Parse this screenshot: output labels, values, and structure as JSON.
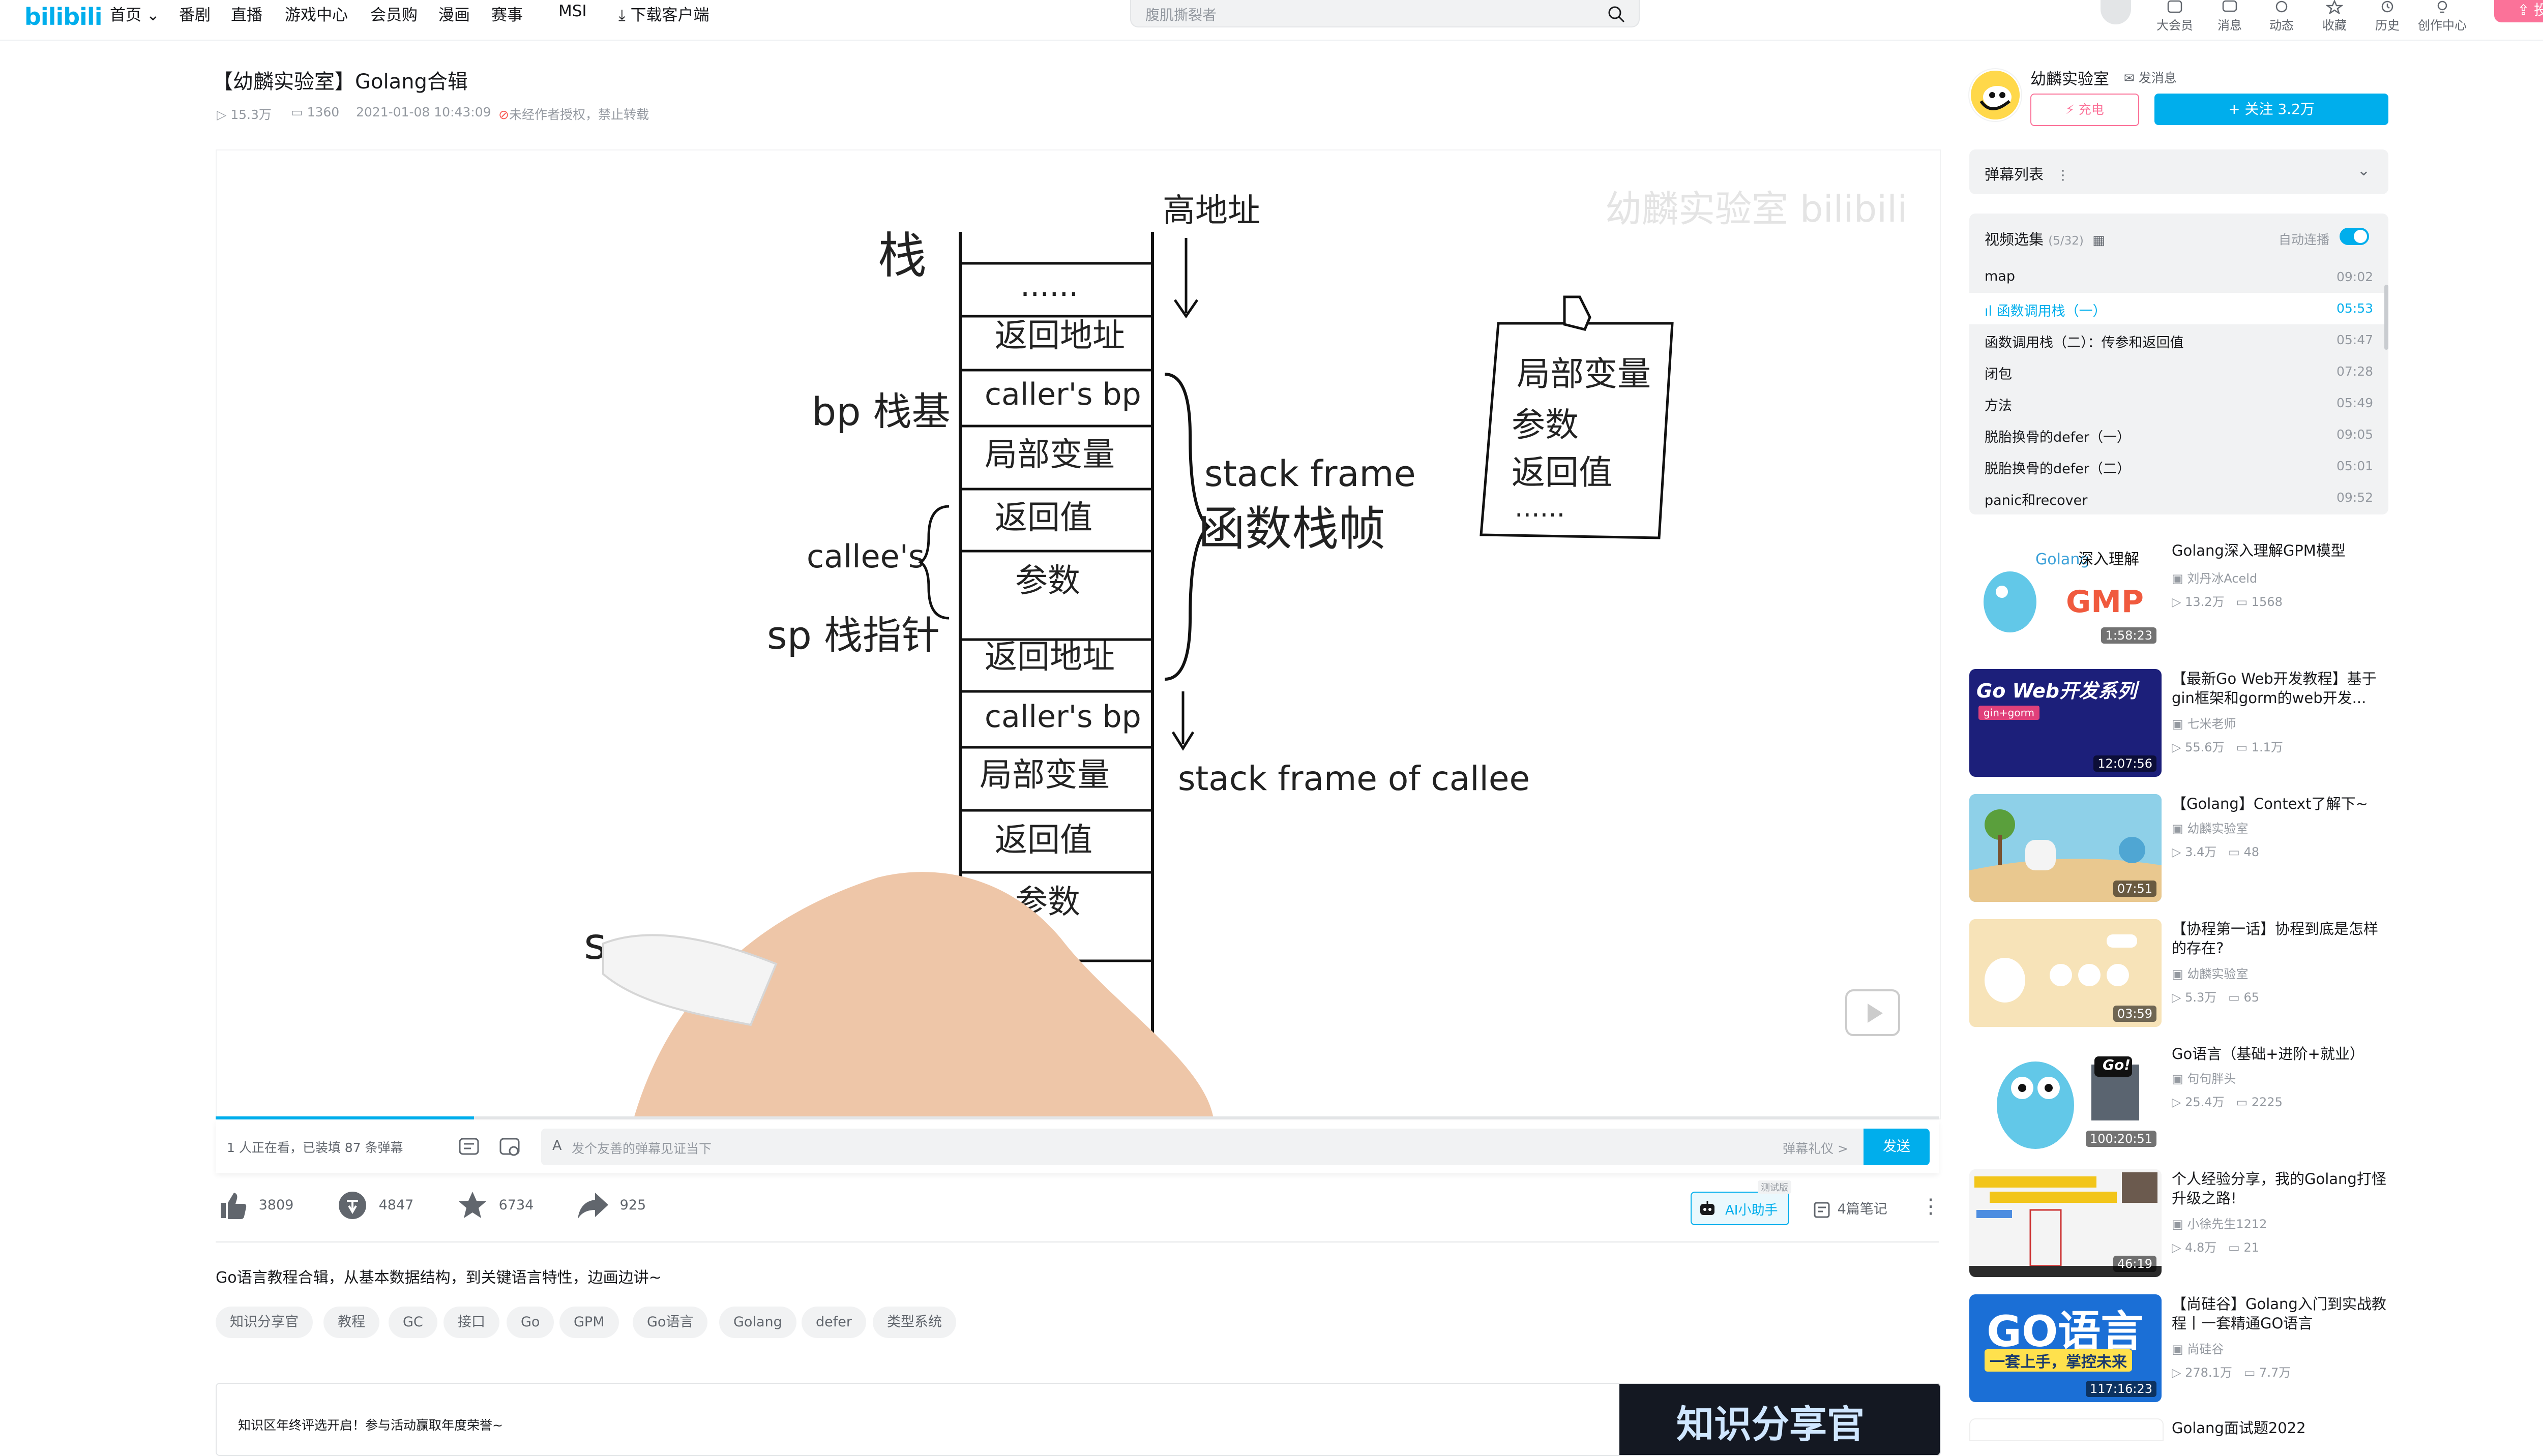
{
  "header": {
    "logo": "bilibili",
    "nav": [
      "首页",
      "番剧",
      "直播",
      "游戏中心",
      "会员购",
      "漫画",
      "赛事",
      "MSI",
      "下载客户端"
    ],
    "search_placeholder": "腹肌撕裂者",
    "icons": [
      "大会员",
      "消息",
      "动态",
      "收藏",
      "历史",
      "创作中心"
    ],
    "upload": "投稿"
  },
  "video": {
    "title": "【幼麟实验室】Golang合辑",
    "views": "15.3万",
    "danmaku_count": "1360",
    "date": "2021-01-08 10:43:09",
    "copyright": "未经作者授权，禁止转载",
    "watermark": "幼麟实验室 bilibili",
    "frame_labels": {
      "stack": "栈",
      "high_addr": "高地址",
      "bp": "bp 栈基",
      "callees": "callee's",
      "sp": "sp 栈指针",
      "stack_frame_en": "stack frame",
      "stack_frame_cn": "函数栈帧",
      "stack_frame_callee": "stack frame of callee",
      "cells": [
        "......",
        "返回地址",
        "caller's bp",
        "局部变量",
        "返回值",
        "参数",
        "返回地址",
        "caller's bp",
        "局部变量",
        "返回值",
        "参数"
      ],
      "note": [
        "局部变量",
        "参数",
        "返回值",
        "......"
      ],
      "writing": "s"
    },
    "progress": 0.15
  },
  "danmaku_bar": {
    "viewers": "1 人正在看，已装填 87 条弹幕",
    "placeholder": "发个友善的弹幕见证当下",
    "etiquette": "弹幕礼仪 >",
    "send": "发送"
  },
  "toolbar": {
    "like": "3809",
    "coin": "4847",
    "favorite": "6734",
    "share": "925",
    "ai_badge": "测试版",
    "ai_assistant": "AI小助手",
    "notes": "4篇笔记"
  },
  "description": "Go语言教程合辑，从基本数据结构，到关键语言特性，边画边讲~",
  "tags": [
    "知识分享官",
    "教程",
    "GC",
    "接口",
    "Go",
    "GPM",
    "Go语言",
    "Golang",
    "defer",
    "类型系统"
  ],
  "banner": {
    "text": "知识区年终评选开启！参与活动赢取年度荣誉~",
    "image_text": "知识分享官"
  },
  "uploader": {
    "name": "幼麟实验室",
    "message": "发消息",
    "charge": "充电",
    "follow": "+ 关注 3.2万"
  },
  "danmaku_list": {
    "title": "弹幕列表"
  },
  "playlist": {
    "title": "视频选集",
    "count": "(5/32)",
    "autoplay": "自动连播",
    "episodes": [
      {
        "title": "map",
        "duration": "09:02"
      },
      {
        "title": "函数调用栈（一）",
        "duration": "05:53"
      },
      {
        "title": "函数调用栈（二）：传参和返回值",
        "duration": "05:47"
      },
      {
        "title": "闭包",
        "duration": "07:28"
      },
      {
        "title": "方法",
        "duration": "05:49"
      },
      {
        "title": "脱胎换骨的defer（一）",
        "duration": "09:05"
      },
      {
        "title": "脱胎换骨的defer（二）",
        "duration": "05:01"
      },
      {
        "title": "panic和recover",
        "duration": "09:52"
      }
    ],
    "active_index": 1
  },
  "recommendations": [
    {
      "title": "Golang深入理解GPM模型",
      "up": "刘丹冰Aceld",
      "views": "13.2万",
      "danmaku": "1568",
      "duration": "1:58:23",
      "thumb_text": "Golang 深入理解 GMP",
      "color": "#ffffff"
    },
    {
      "title": "【最新Go Web开发教程】基于gin框架和gorm的web开发...",
      "up": "七米老师",
      "views": "55.6万",
      "danmaku": "1.1万",
      "duration": "12:07:56",
      "thumb_text": "Go Web开发系列",
      "color": "#1c1f7a"
    },
    {
      "title": "【Golang】Context了解下~",
      "up": "幼麟实验室",
      "views": "3.4万",
      "danmaku": "48",
      "duration": "07:51",
      "thumb_text": "",
      "color": "#8ed0e8"
    },
    {
      "title": "【协程第一话】协程到底是怎样的存在?",
      "up": "幼麟实验室",
      "views": "5.3万",
      "danmaku": "65",
      "duration": "03:59",
      "thumb_text": "",
      "color": "#f7e3b8"
    },
    {
      "title": "Go语言（基础+进阶+就业）",
      "up": "句句胖头",
      "views": "25.4万",
      "danmaku": "2225",
      "duration": "100:20:51",
      "thumb_text": "Go!",
      "color": "#ffffff"
    },
    {
      "title": "个人经验分享，我的Golang打怪升级之路!",
      "up": "小徐先生1212",
      "views": "4.8万",
      "danmaku": "21",
      "duration": "46:19",
      "thumb_text": "",
      "color": "#f4f4f4"
    },
    {
      "title": "【尚硅谷】Golang入门到实战教程丨一套精通GO语言",
      "up": "尚硅谷",
      "views": "278.1万",
      "danmaku": "7.7万",
      "duration": "117:16:23",
      "thumb_text": "GO语言",
      "color": "#1b6fd6"
    },
    {
      "title": "Golang面试题2022",
      "up": "",
      "views": "",
      "danmaku": "",
      "duration": "",
      "thumb_text": "",
      "color": "#ffffff"
    }
  ],
  "rec_thumb_sub": [
    "",
    "gin+gorm",
    "",
    "",
    "",
    "",
    "一套上手，掌控未来",
    ""
  ]
}
